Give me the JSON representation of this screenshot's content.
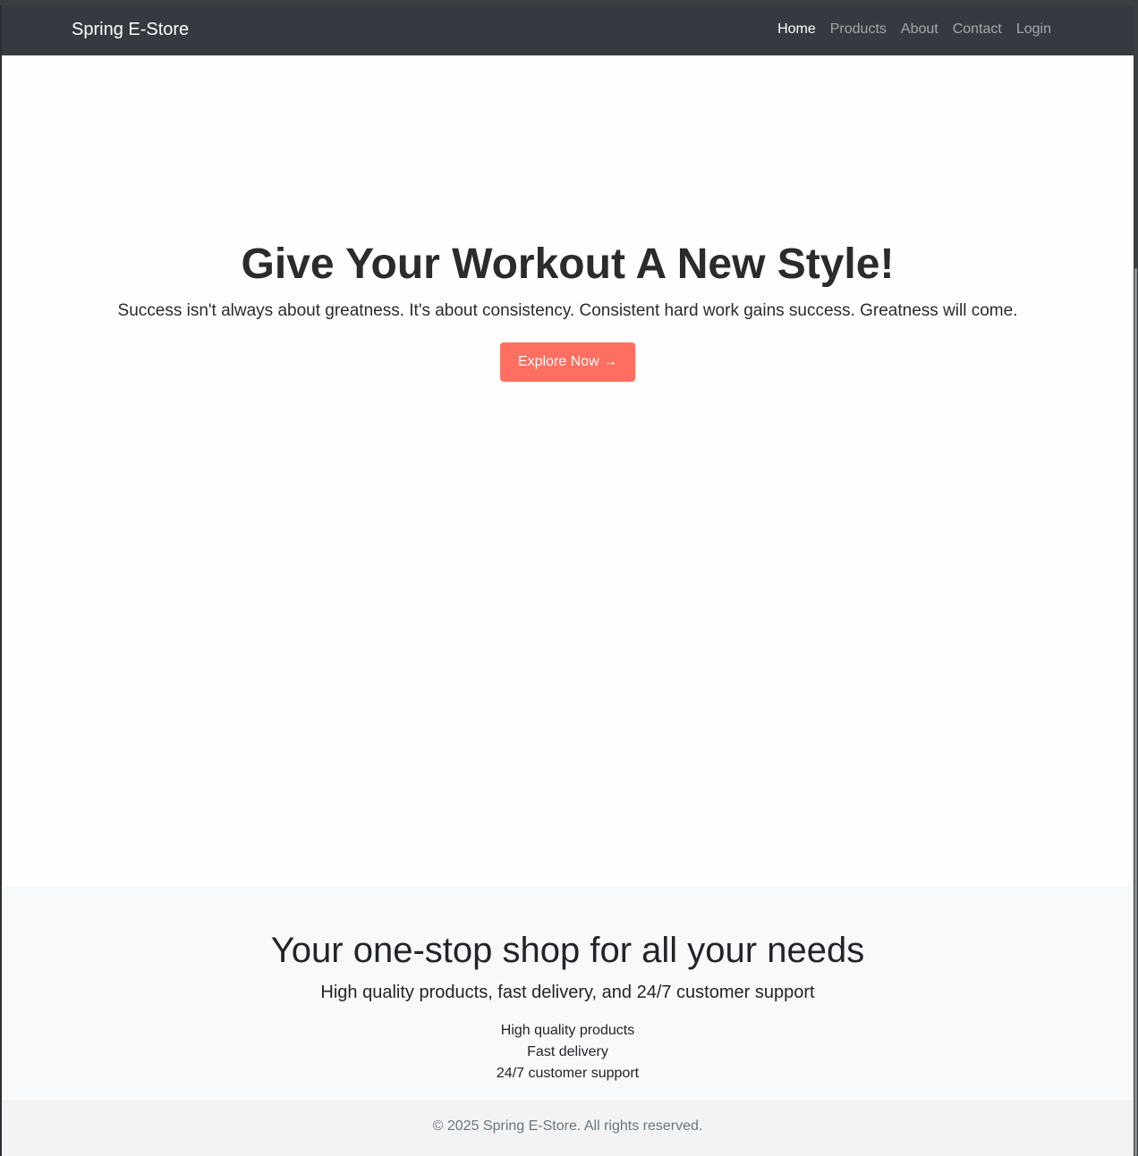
{
  "navbar": {
    "brand": "Spring E-Store",
    "links": [
      {
        "label": "Home",
        "active": true
      },
      {
        "label": "Products",
        "active": false
      },
      {
        "label": "About",
        "active": false
      },
      {
        "label": "Contact",
        "active": false
      },
      {
        "label": "Login",
        "active": false
      }
    ]
  },
  "hero": {
    "title": "Give Your Workout A New Style!",
    "subtitle": "Success isn't always about greatness. It's about consistency. Consistent hard work gains success. Greatness will come.",
    "cta_label": "Explore Now →",
    "cta_color": "#ff6f61"
  },
  "features": {
    "title": "Your one-stop shop for all your needs",
    "lead": "High quality products, fast delivery, and 24/7 customer support",
    "items": [
      "High quality products",
      "Fast delivery",
      "24/7 customer support"
    ]
  },
  "footer": {
    "text": "© 2025 Spring E-Store. All rights reserved."
  },
  "colors": {
    "navbar_bg": "#343a40",
    "accent": "#ff6f61",
    "features_bg": "#f8f9fa"
  }
}
